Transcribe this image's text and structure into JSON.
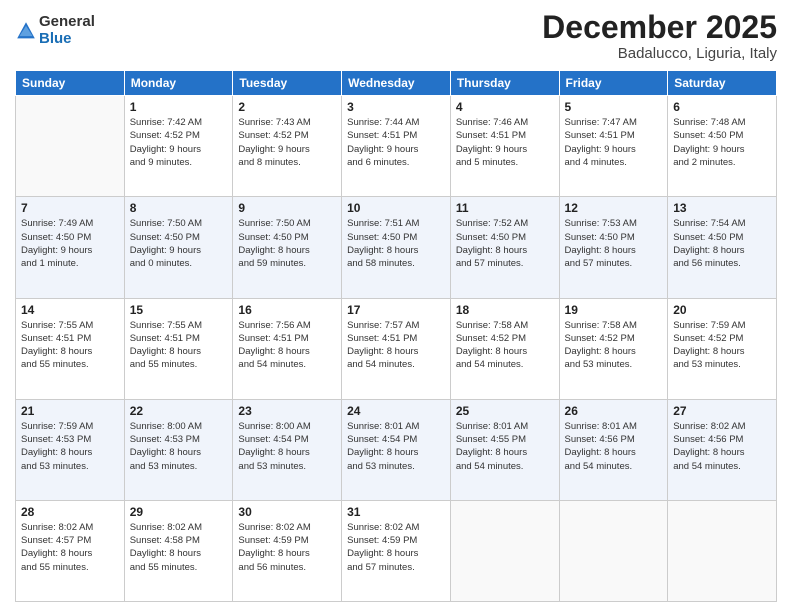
{
  "logo": {
    "general": "General",
    "blue": "Blue"
  },
  "header": {
    "title": "December 2025",
    "subtitle": "Badalucco, Liguria, Italy"
  },
  "weekdays": [
    "Sunday",
    "Monday",
    "Tuesday",
    "Wednesday",
    "Thursday",
    "Friday",
    "Saturday"
  ],
  "weeks": [
    [
      {
        "day": "",
        "info": ""
      },
      {
        "day": "1",
        "info": "Sunrise: 7:42 AM\nSunset: 4:52 PM\nDaylight: 9 hours\nand 9 minutes."
      },
      {
        "day": "2",
        "info": "Sunrise: 7:43 AM\nSunset: 4:52 PM\nDaylight: 9 hours\nand 8 minutes."
      },
      {
        "day": "3",
        "info": "Sunrise: 7:44 AM\nSunset: 4:51 PM\nDaylight: 9 hours\nand 6 minutes."
      },
      {
        "day": "4",
        "info": "Sunrise: 7:46 AM\nSunset: 4:51 PM\nDaylight: 9 hours\nand 5 minutes."
      },
      {
        "day": "5",
        "info": "Sunrise: 7:47 AM\nSunset: 4:51 PM\nDaylight: 9 hours\nand 4 minutes."
      },
      {
        "day": "6",
        "info": "Sunrise: 7:48 AM\nSunset: 4:50 PM\nDaylight: 9 hours\nand 2 minutes."
      }
    ],
    [
      {
        "day": "7",
        "info": "Sunrise: 7:49 AM\nSunset: 4:50 PM\nDaylight: 9 hours\nand 1 minute."
      },
      {
        "day": "8",
        "info": "Sunrise: 7:50 AM\nSunset: 4:50 PM\nDaylight: 9 hours\nand 0 minutes."
      },
      {
        "day": "9",
        "info": "Sunrise: 7:50 AM\nSunset: 4:50 PM\nDaylight: 8 hours\nand 59 minutes."
      },
      {
        "day": "10",
        "info": "Sunrise: 7:51 AM\nSunset: 4:50 PM\nDaylight: 8 hours\nand 58 minutes."
      },
      {
        "day": "11",
        "info": "Sunrise: 7:52 AM\nSunset: 4:50 PM\nDaylight: 8 hours\nand 57 minutes."
      },
      {
        "day": "12",
        "info": "Sunrise: 7:53 AM\nSunset: 4:50 PM\nDaylight: 8 hours\nand 57 minutes."
      },
      {
        "day": "13",
        "info": "Sunrise: 7:54 AM\nSunset: 4:50 PM\nDaylight: 8 hours\nand 56 minutes."
      }
    ],
    [
      {
        "day": "14",
        "info": "Sunrise: 7:55 AM\nSunset: 4:51 PM\nDaylight: 8 hours\nand 55 minutes."
      },
      {
        "day": "15",
        "info": "Sunrise: 7:55 AM\nSunset: 4:51 PM\nDaylight: 8 hours\nand 55 minutes."
      },
      {
        "day": "16",
        "info": "Sunrise: 7:56 AM\nSunset: 4:51 PM\nDaylight: 8 hours\nand 54 minutes."
      },
      {
        "day": "17",
        "info": "Sunrise: 7:57 AM\nSunset: 4:51 PM\nDaylight: 8 hours\nand 54 minutes."
      },
      {
        "day": "18",
        "info": "Sunrise: 7:58 AM\nSunset: 4:52 PM\nDaylight: 8 hours\nand 54 minutes."
      },
      {
        "day": "19",
        "info": "Sunrise: 7:58 AM\nSunset: 4:52 PM\nDaylight: 8 hours\nand 53 minutes."
      },
      {
        "day": "20",
        "info": "Sunrise: 7:59 AM\nSunset: 4:52 PM\nDaylight: 8 hours\nand 53 minutes."
      }
    ],
    [
      {
        "day": "21",
        "info": "Sunrise: 7:59 AM\nSunset: 4:53 PM\nDaylight: 8 hours\nand 53 minutes."
      },
      {
        "day": "22",
        "info": "Sunrise: 8:00 AM\nSunset: 4:53 PM\nDaylight: 8 hours\nand 53 minutes."
      },
      {
        "day": "23",
        "info": "Sunrise: 8:00 AM\nSunset: 4:54 PM\nDaylight: 8 hours\nand 53 minutes."
      },
      {
        "day": "24",
        "info": "Sunrise: 8:01 AM\nSunset: 4:54 PM\nDaylight: 8 hours\nand 53 minutes."
      },
      {
        "day": "25",
        "info": "Sunrise: 8:01 AM\nSunset: 4:55 PM\nDaylight: 8 hours\nand 54 minutes."
      },
      {
        "day": "26",
        "info": "Sunrise: 8:01 AM\nSunset: 4:56 PM\nDaylight: 8 hours\nand 54 minutes."
      },
      {
        "day": "27",
        "info": "Sunrise: 8:02 AM\nSunset: 4:56 PM\nDaylight: 8 hours\nand 54 minutes."
      }
    ],
    [
      {
        "day": "28",
        "info": "Sunrise: 8:02 AM\nSunset: 4:57 PM\nDaylight: 8 hours\nand 55 minutes."
      },
      {
        "day": "29",
        "info": "Sunrise: 8:02 AM\nSunset: 4:58 PM\nDaylight: 8 hours\nand 55 minutes."
      },
      {
        "day": "30",
        "info": "Sunrise: 8:02 AM\nSunset: 4:59 PM\nDaylight: 8 hours\nand 56 minutes."
      },
      {
        "day": "31",
        "info": "Sunrise: 8:02 AM\nSunset: 4:59 PM\nDaylight: 8 hours\nand 57 minutes."
      },
      {
        "day": "",
        "info": ""
      },
      {
        "day": "",
        "info": ""
      },
      {
        "day": "",
        "info": ""
      }
    ]
  ]
}
